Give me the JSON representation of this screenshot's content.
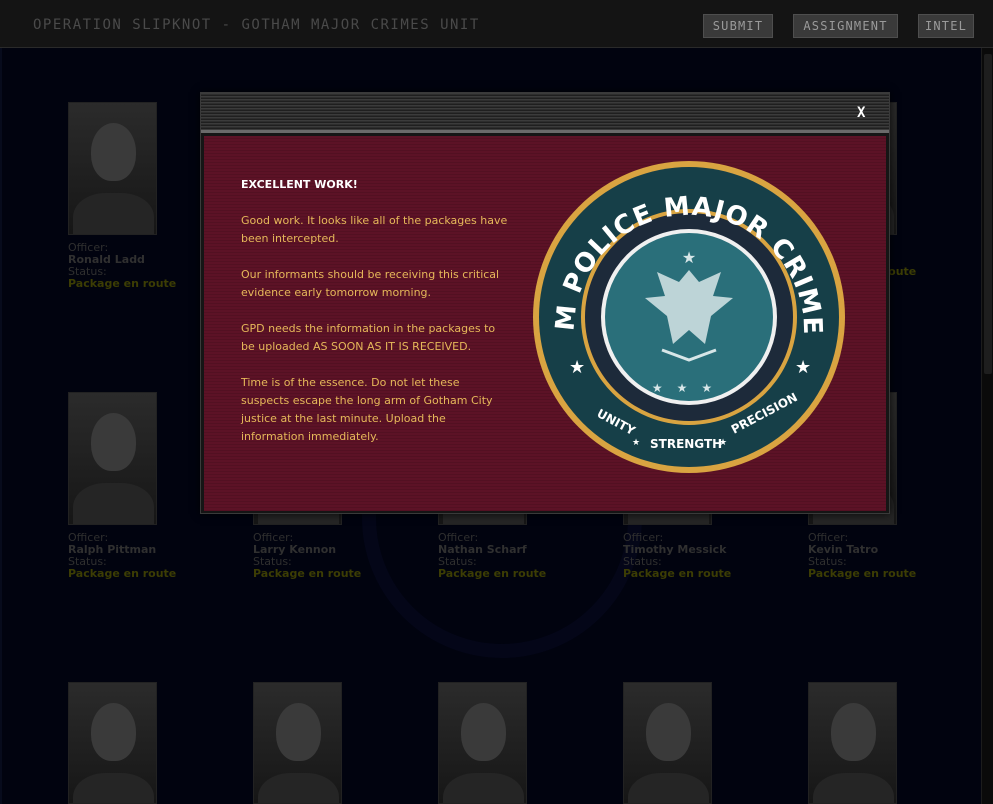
{
  "header": {
    "title": "OPERATION SLIPKNOT - GOTHAM MAJOR CRIMES UNIT",
    "nav": {
      "submit": "SUBMIT",
      "assignment": "ASSIGNMENT",
      "intel": "INTEL"
    }
  },
  "officer_labels": {
    "officer": "Officer:",
    "status": "Status:"
  },
  "officers": [
    {
      "name": "Ronald Ladd",
      "status": "Package en route"
    },
    {
      "name": "",
      "status": "Package en route"
    },
    {
      "name": "Ralph Pittman",
      "status": "Package en route"
    },
    {
      "name": "Larry Kennon",
      "status": "Package en route"
    },
    {
      "name": "Nathan Scharf",
      "status": "Package en route"
    },
    {
      "name": "Timothy Messick",
      "status": "Package en route"
    },
    {
      "name": "Kevin Tatro",
      "status": "Package en route"
    }
  ],
  "modal": {
    "close": "X",
    "headline": "EXCELLENT WORK!",
    "paragraphs": [
      "Good work. It looks like all of the packages have been intercepted.",
      "Our informants should be receiving this critical evidence early tomorrow morning.",
      "GPD needs the information in the packages to be uploaded AS SOON AS IT IS RECEIVED.",
      "Time is of the essence. Do not let these suspects escape the long arm of Gotham City justice at the last minute. Upload the information immediately."
    ],
    "seal": {
      "top_text": "GOTHAM POLICE MAJOR CRIMES UNIT",
      "bottom_words": [
        "UNITY",
        "STRENGTH",
        "PRECISION"
      ],
      "colors": {
        "ring": "#163f48",
        "gold": "#d9a441",
        "inner": "#2a6f7a",
        "navy": "#1d2a3a"
      }
    }
  }
}
